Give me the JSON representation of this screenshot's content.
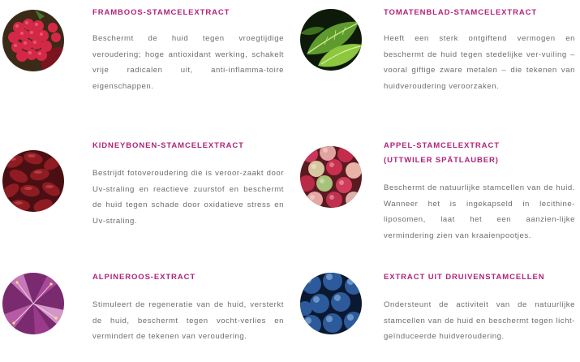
{
  "items": [
    {
      "title": "FRAMBOOS-STAMCELEXTRACT",
      "description": "Beschermt de huid tegen vroegtijdige veroudering; hoge antioxidant werking, schakelt vrije radicalen uit, anti-inflamma-toire eigenschappen.",
      "image": "raspberry-image"
    },
    {
      "title": "TOMATENBLAD-STAMCELEXTRACT",
      "description": "Heeft een sterk ontgiftend vermogen en beschermt de huid tegen stedelijke ver-vuiling – vooral giftige zware metalen – die tekenen van huidveroudering veroorzaken.",
      "image": "tomato-leaf-image"
    },
    {
      "title": "KIDNEYBONEN-STAMCELEXTRACT",
      "description": "Bestrijdt fotoveroudering die is veroor-zaakt door Uv-straling en reactieve zuurstof en beschermt de huid tegen schade door oxidatieve stress en Uv-straling.",
      "image": "kidney-beans-image"
    },
    {
      "title_lines": [
        "APPEL-STAMCELEXTRACT",
        "(UTTWILER SPÄTLAUBER)"
      ],
      "description": "Beschermt de natuurlijke stamcellen van de huid. Wanneer het is ingekapseld in lecithine-liposomen, laat het een aanzien-lijke vermindering zien van kraaienpootjes.",
      "image": "apples-image"
    },
    {
      "title": "ALPINEROOS-EXTRACT",
      "description": "Stimuleert de regeneratie van de huid, versterkt de huid, beschermt tegen vocht-verlies en vermindert de tekenen van veroudering.",
      "image": "alpine-rose-image"
    },
    {
      "title": "EXTRACT UIT DRUIVENSTAMCELLEN",
      "description": "Ondersteunt de activiteit van de natuurlijke stamcellen van de huid en beschermt tegen licht-geïnduceerde huidveroudering.",
      "image": "grapes-image"
    }
  ],
  "colors": {
    "title": "#b0237a",
    "text": "#6d6d6d",
    "background": "#ffffff"
  }
}
